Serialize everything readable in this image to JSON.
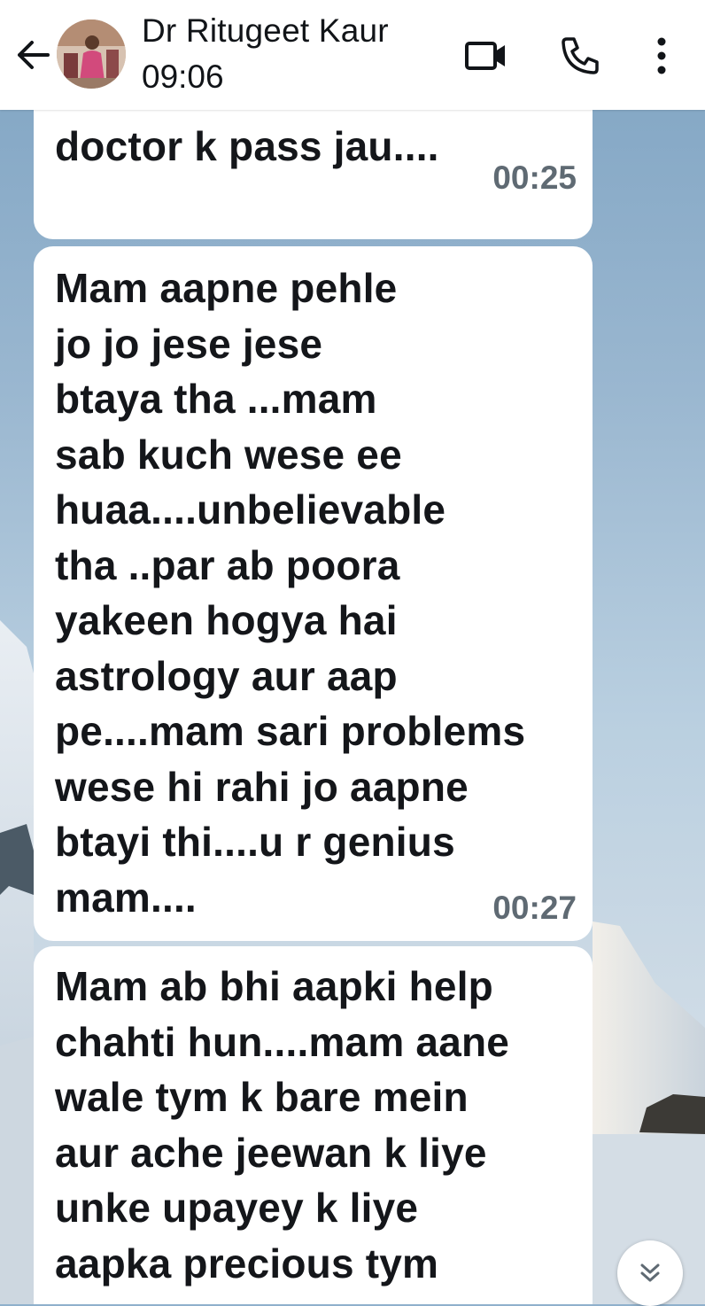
{
  "header": {
    "contact_name": "Dr Ritugeet Kaur",
    "last_seen": "09:06",
    "icons": {
      "back": "arrow-left-icon",
      "video": "video-camera-icon",
      "call": "phone-icon",
      "menu": "more-vertical-icon"
    }
  },
  "messages": [
    {
      "text": "doctor k pass jau....",
      "time": "00:25"
    },
    {
      "text": "Mam aapne pehle\njo jo jese jese\nbtaya tha ...mam\nsab kuch wese ee\nhuaa....unbelievable\ntha ..par ab poora\nyakeen hogya hai\nastrology aur aap\npe....mam sari problems\nwese hi rahi jo aapne\nbtayi thi....u r genius\nmam....",
      "time": "00:27"
    },
    {
      "text": "Mam ab bhi aapki help\nchahti hun....mam aane\nwale tym k bare mein\naur ache jeewan k liye\nunke upayey k liye\naapka precious tym",
      "time": ""
    }
  ],
  "scroll_button_icon": "chevron-double-down-icon",
  "colors": {
    "appbar_bg": "#ffffff",
    "bubble_bg": "#ffffff",
    "text": "#14161a",
    "timestamp": "#5f6a73"
  }
}
